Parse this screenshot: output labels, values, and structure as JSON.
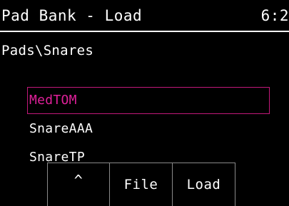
{
  "header": {
    "title": "Pad Bank - Load",
    "clock": "6:2"
  },
  "browser": {
    "path": "Pads\\Snares",
    "items": [
      {
        "label": "MedTOM",
        "selected": true
      },
      {
        "label": "SnareAAA",
        "selected": false
      },
      {
        "label": "SnareTP",
        "selected": false
      }
    ]
  },
  "softkeys": {
    "up": "^",
    "file": "File",
    "load": "Load"
  },
  "colors": {
    "background": "#000000",
    "text": "#ffffff",
    "selection": "#e0209a",
    "key_border": "#8a8a8a"
  }
}
